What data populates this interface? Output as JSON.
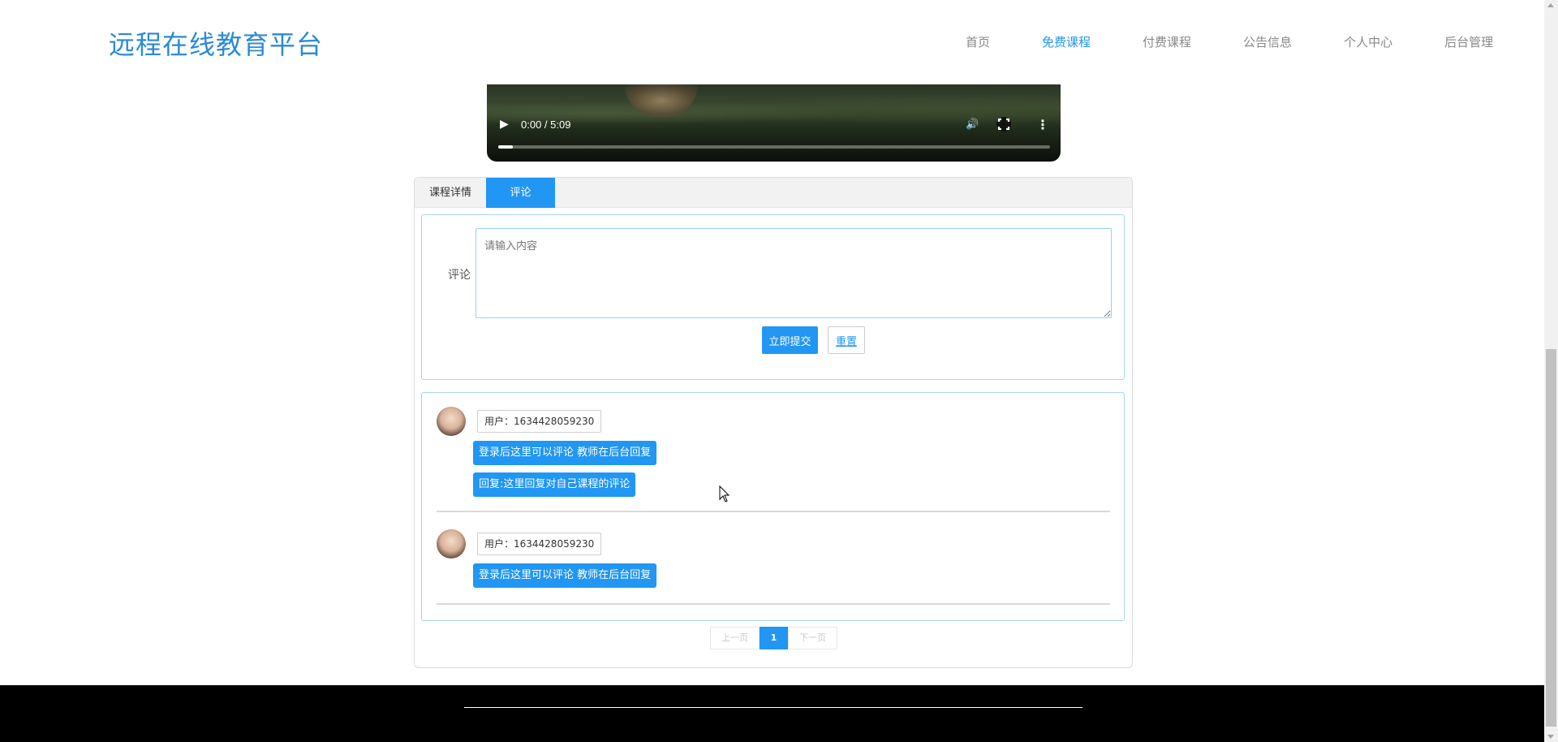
{
  "header": {
    "logo": "远程在线教育平台",
    "nav": [
      {
        "label": "首页",
        "active": false
      },
      {
        "label": "免费课程",
        "active": true
      },
      {
        "label": "付费课程",
        "active": false
      },
      {
        "label": "公告信息",
        "active": false
      },
      {
        "label": "个人中心",
        "active": false
      },
      {
        "label": "后台管理",
        "active": false
      }
    ]
  },
  "video": {
    "time": "0:00 / 5:09",
    "progress_fraction": 0.0,
    "play_icon": "play-icon",
    "volume_icon": "volume-icon",
    "fullscreen_icon": "fullscreen-icon",
    "more_icon": "more-vert-icon"
  },
  "tabs": {
    "details": "课程详情",
    "comments": "评论",
    "active": "comments"
  },
  "form": {
    "label": "评论",
    "placeholder": "请输入内容",
    "submit": "立即提交",
    "reset": "重置"
  },
  "comments": [
    {
      "user": "用户：1634428059230",
      "content": "登录后这里可以评论 教师在后台回复",
      "reply": "回复:这里回复对自己课程的评论"
    },
    {
      "user": "用户：1634428059230",
      "content": "登录后这里可以评论 教师在后台回复",
      "reply": null
    }
  ],
  "pager": {
    "prev": "上一页",
    "current": "1",
    "next": "下一页"
  },
  "colors": {
    "accent": "#2196f3",
    "logo": "#2b8ad6",
    "footer": "#000000"
  }
}
